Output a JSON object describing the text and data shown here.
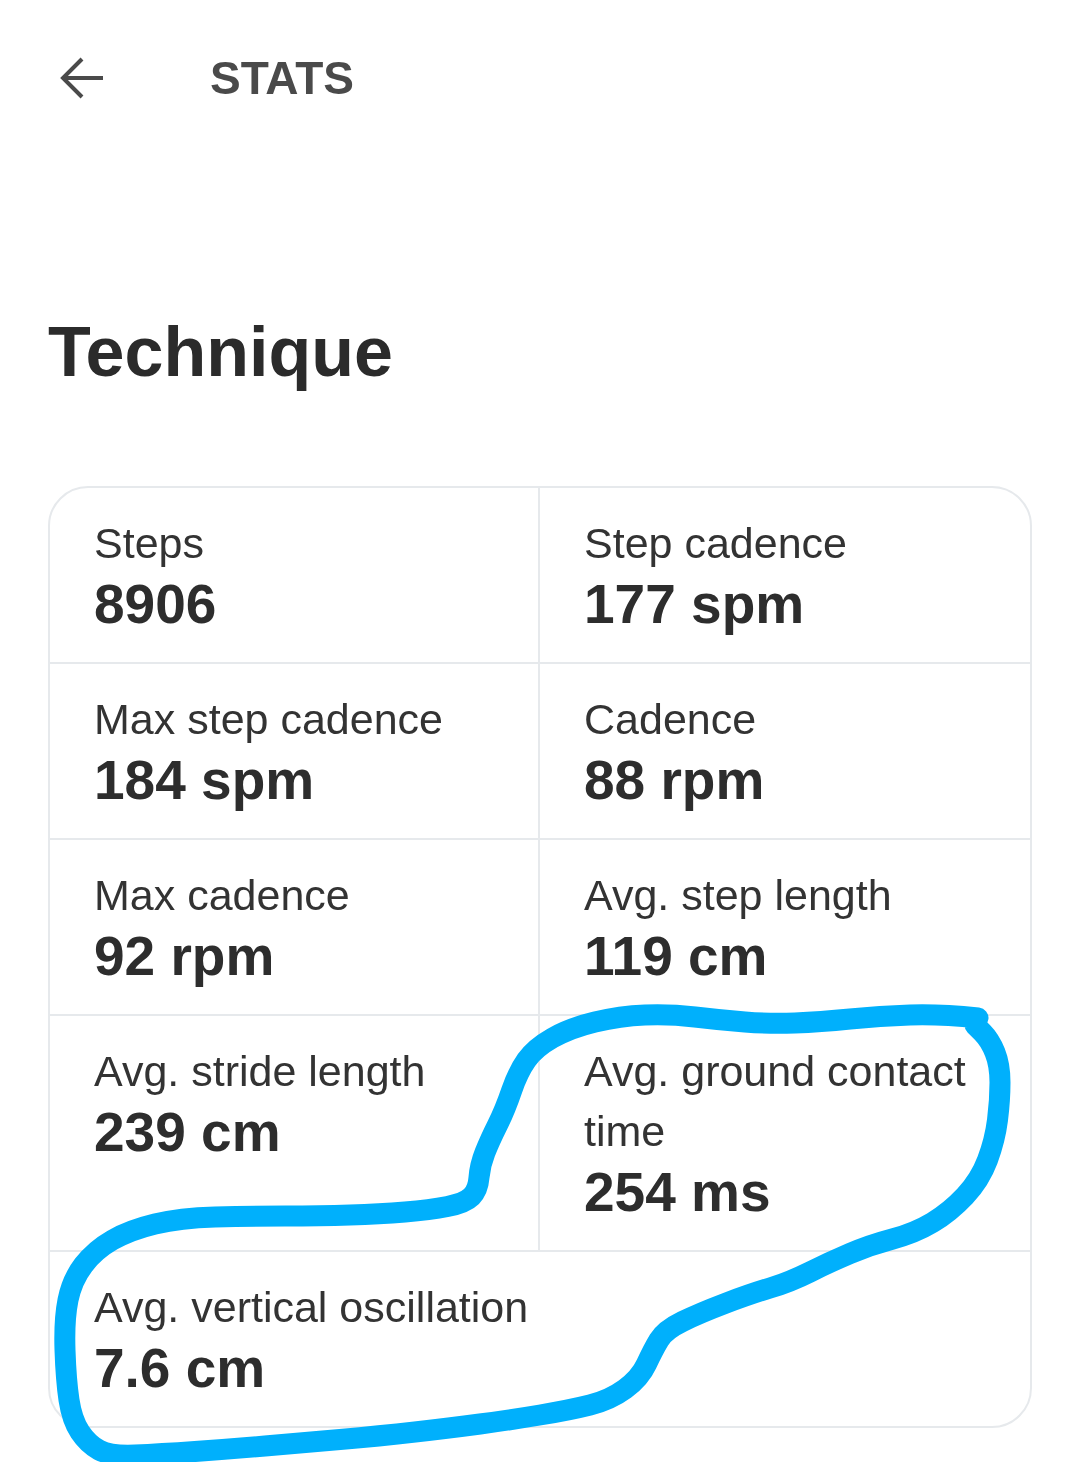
{
  "header": {
    "title": "STATS"
  },
  "section": {
    "title": "Technique"
  },
  "stats": [
    {
      "label": "Steps",
      "value": "8906"
    },
    {
      "label": "Step cadence",
      "value": "177 spm"
    },
    {
      "label": "Max step cadence",
      "value": "184 spm"
    },
    {
      "label": "Cadence",
      "value": "88 rpm"
    },
    {
      "label": "Max cadence",
      "value": "92 rpm"
    },
    {
      "label": "Avg. step length",
      "value": "119 cm"
    },
    {
      "label": "Avg. stride length",
      "value": "239 cm"
    },
    {
      "label": "Avg. ground contact time",
      "value": "254 ms"
    },
    {
      "label": "Avg. vertical oscillation",
      "value": "7.6 cm"
    }
  ],
  "annotation": {
    "kind": "freehand-loop"
  }
}
